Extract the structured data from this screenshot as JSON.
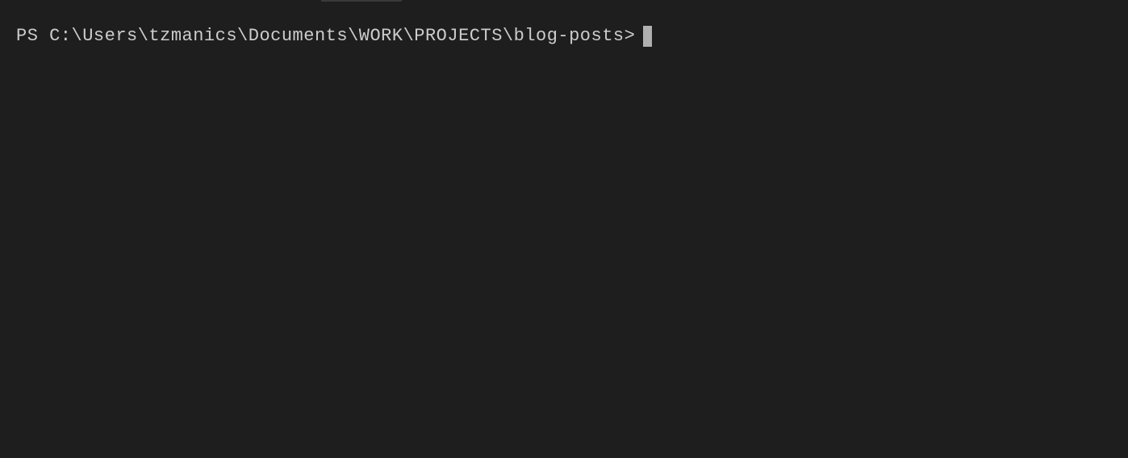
{
  "terminal": {
    "prompt": "PS C:\\Users\\tzmanics\\Documents\\WORK\\PROJECTS\\blog-posts>"
  }
}
